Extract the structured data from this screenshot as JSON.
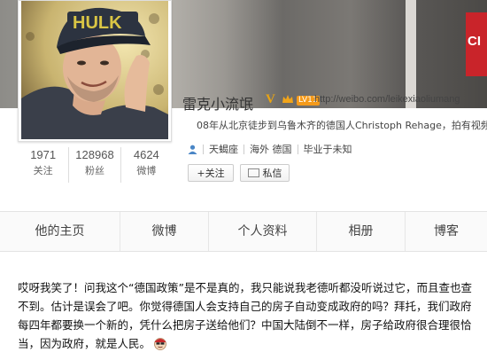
{
  "banner": {
    "poster_text": "CI"
  },
  "stats": [
    {
      "value": "1971",
      "label": "关注"
    },
    {
      "value": "128968",
      "label": "粉丝"
    },
    {
      "value": "4624",
      "label": "微博"
    }
  ],
  "profile": {
    "name": "雷克小流氓",
    "verified_mark": "V",
    "level": "LV11",
    "url": "http://weibo.com/leikexiaoliumang",
    "description": "08年从北京徒步到乌鲁木齐的德国人Christoph Rehage，拍有视频",
    "constellation": "天蝎座",
    "location": "海外 德国",
    "school": "毕业于未知"
  },
  "actions": {
    "follow_label": "+关注",
    "message_label": "私信"
  },
  "tabs": [
    "他的主页",
    "微博",
    "个人资料",
    "相册",
    "博客"
  ],
  "post": {
    "text": "哎呀我笑了！问我这个“德国政策”是不是真的，我只能说我老德听都没听说过它，而且查也查不到。估计是误会了吧。你觉得德国人会支持自己的房子自动变成政府的吗？拜托，我们政府每四年都要换一个新的，凭什么把房子送给他们？中国大陆倒不一样，房子给政府很合理很恰当，因为政府，就是人民。",
    "emoji": "cool-face-emoji"
  },
  "colors": {
    "accent": "#f49a1a",
    "verified": "#e8a313",
    "poster": "#c9242a"
  }
}
